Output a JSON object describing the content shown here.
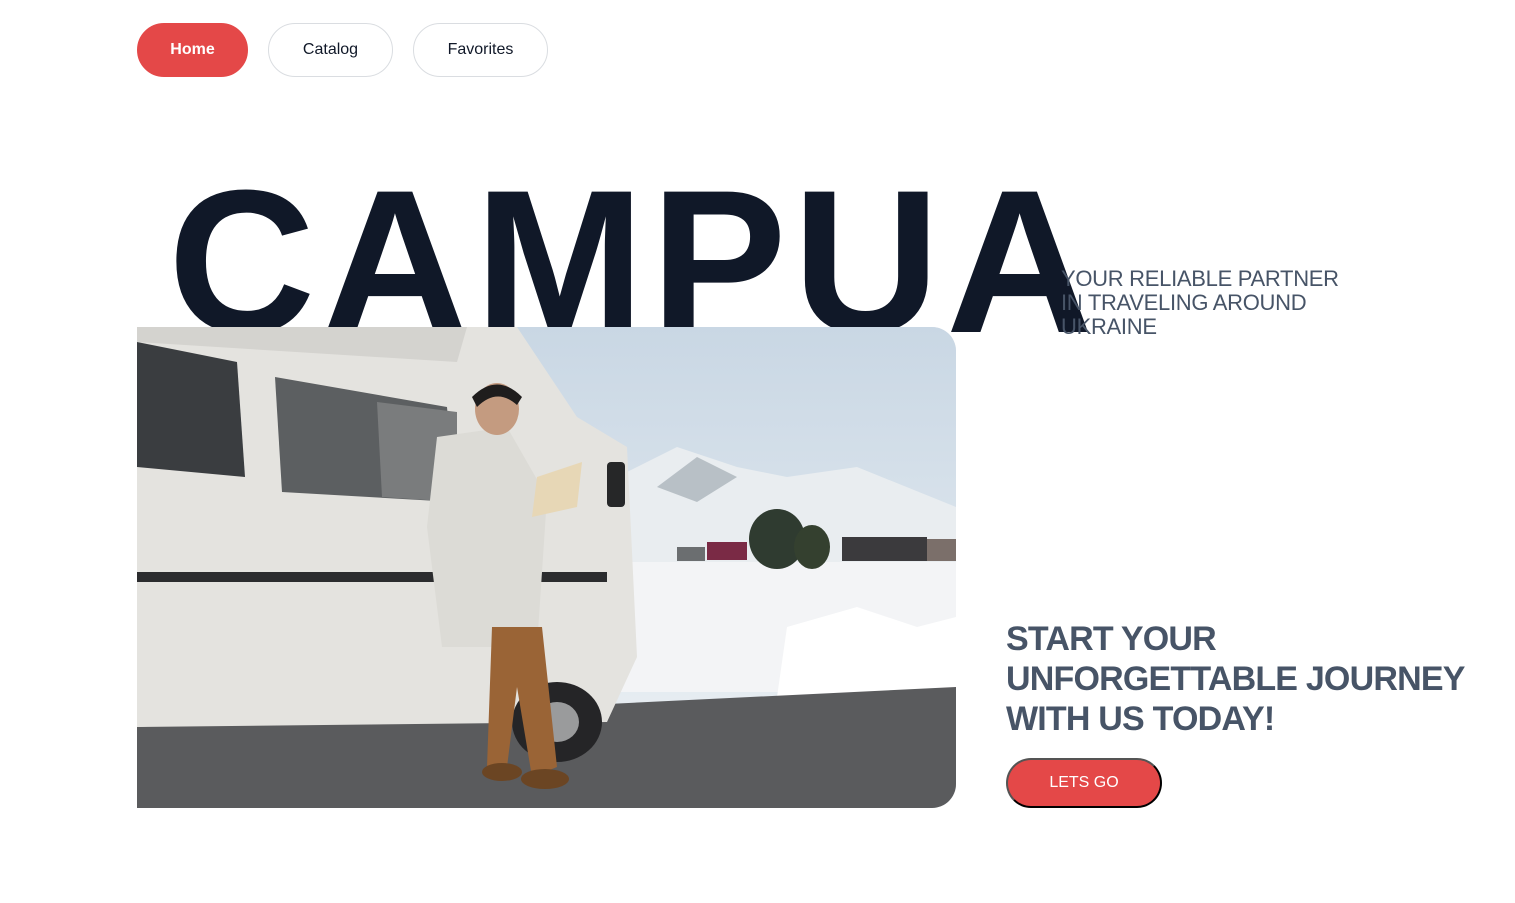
{
  "nav": {
    "home_label": "Home",
    "catalog_label": "Catalog",
    "favorites_label": "Favorites",
    "active": "Home"
  },
  "hero": {
    "brand": "CAMPUA",
    "tagline": "YOUR RELIABLE PARTNER IN TRAVELING AROUND UKRAINE",
    "cta_title": "START YOUR UNFORGETTABLE JOURNEY WITH US TODAY!",
    "cta_button": "LETS GO"
  },
  "colors": {
    "accent": "#e44848",
    "text_dark": "#101828",
    "text_muted": "#475467",
    "border": "#dadde1",
    "background": "#ffffff"
  }
}
